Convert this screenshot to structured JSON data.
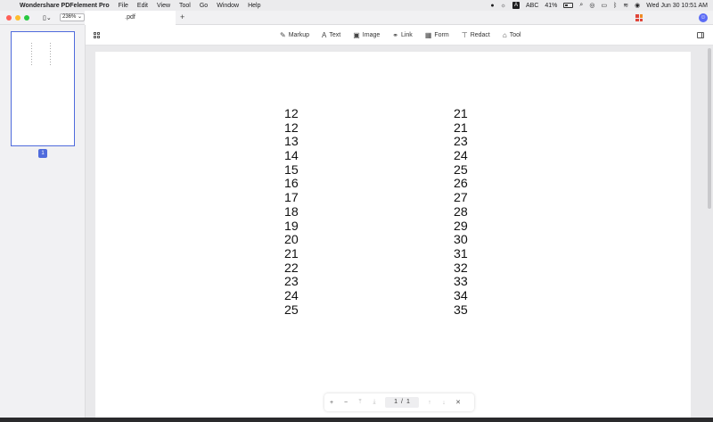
{
  "menubar": {
    "app_name": "Wondershare PDFelement Pro",
    "menus": [
      "File",
      "Edit",
      "View",
      "Tool",
      "Go",
      "Window",
      "Help"
    ],
    "input_source": "ABC",
    "battery": "41%",
    "clock": "Wed Jun 30  10:51 AM"
  },
  "tabbar": {
    "zoom": "236%",
    "doc_tab": ".pdf",
    "new_tab": "+"
  },
  "toolbar": {
    "markup": "Markup",
    "text": "Text",
    "image": "Image",
    "link": "Link",
    "form": "Form",
    "redact": "Redact",
    "tool": "Tool"
  },
  "thumbnails": {
    "page_badge": "1"
  },
  "document": {
    "left_column": [
      "12",
      "12",
      "13",
      "14",
      "15",
      "16",
      "17",
      "18",
      "19",
      "20",
      "21",
      "22",
      "23",
      "24",
      "25"
    ],
    "right_column": [
      "21",
      "21",
      "23",
      "24",
      "25",
      "26",
      "27",
      "28",
      "29",
      "30",
      "31",
      "32",
      "33",
      "34",
      "35"
    ]
  },
  "pagenav": {
    "current": "1",
    "separator": "/",
    "total": "1"
  }
}
